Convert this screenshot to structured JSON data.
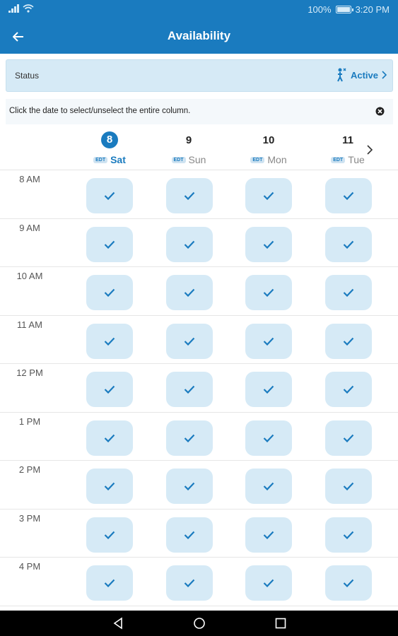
{
  "status_bar": {
    "battery": "100%",
    "time": "3:20 PM"
  },
  "app_bar": {
    "title": "Availability",
    "back_icon": "arrow-left-icon"
  },
  "status": {
    "label": "Status",
    "value": "Active"
  },
  "info": {
    "text": "Click the date to select/unselect the entire column."
  },
  "days": [
    {
      "num": "8",
      "name": "Sat",
      "tz": "EDT",
      "selected": true
    },
    {
      "num": "9",
      "name": "Sun",
      "tz": "EDT",
      "selected": false
    },
    {
      "num": "10",
      "name": "Mon",
      "tz": "EDT",
      "selected": false
    },
    {
      "num": "11",
      "name": "Tue",
      "tz": "EDT",
      "selected": false
    }
  ],
  "hours": [
    "8 AM",
    "9 AM",
    "10 AM",
    "11 AM",
    "12 PM",
    "1 PM",
    "2 PM",
    "3 PM",
    "4 PM"
  ],
  "all_slots_selected": true,
  "colors": {
    "primary": "#1a7bbf",
    "slot_bg": "#d6eaf6",
    "status_bg": "#d6eaf6"
  }
}
